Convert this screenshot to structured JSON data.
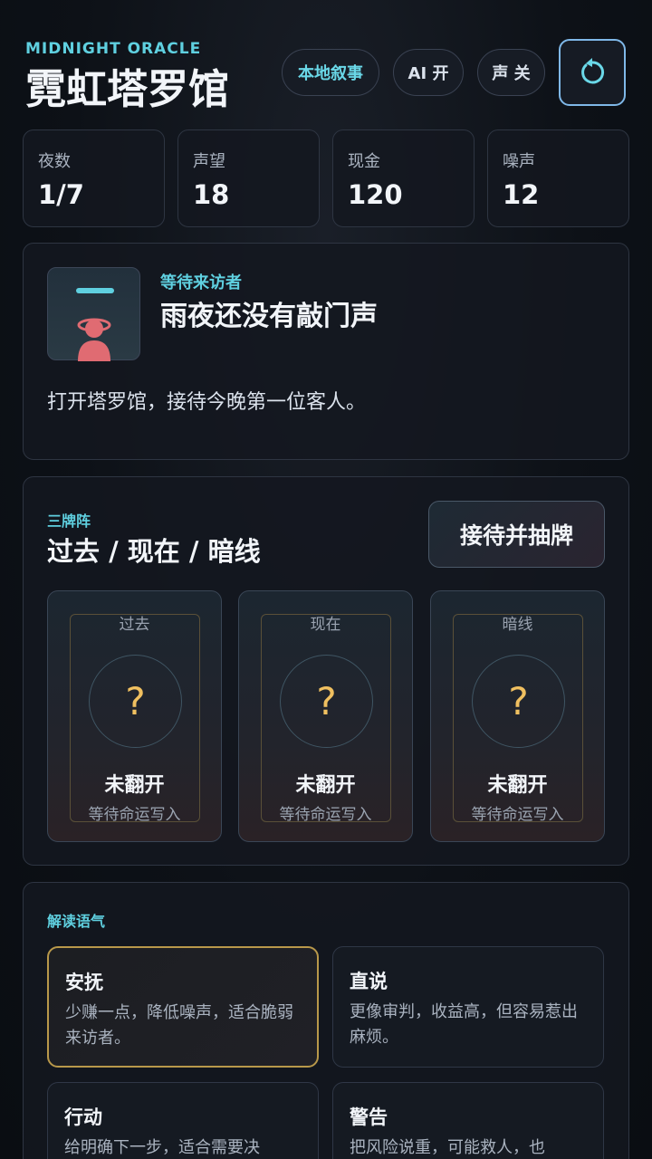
{
  "brand": {
    "subtitle": "MIDNIGHT ORACLE",
    "title": "霓虹塔罗馆"
  },
  "header": {
    "pill_narrative": "本地叙事",
    "pill_ai": "AI 开",
    "pill_sound": "声 关"
  },
  "stats": [
    {
      "label": "夜数",
      "value": "1/7"
    },
    {
      "label": "声望",
      "value": "18"
    },
    {
      "label": "现金",
      "value": "120"
    },
    {
      "label": "噪声",
      "value": "12"
    }
  ],
  "visitor": {
    "status": "等待来访者",
    "title": "雨夜还没有敲门声",
    "description": "打开塔罗馆，接待今晚第一位客人。"
  },
  "spread": {
    "eyebrow": "三牌阵",
    "title": "过去 / 现在 / 暗线",
    "action": "接待并抽牌",
    "cards": [
      {
        "position": "过去",
        "symbol": "?",
        "state": "未翻开",
        "hint": "等待命运写入"
      },
      {
        "position": "现在",
        "symbol": "?",
        "state": "未翻开",
        "hint": "等待命运写入"
      },
      {
        "position": "暗线",
        "symbol": "?",
        "state": "未翻开",
        "hint": "等待命运写入"
      }
    ]
  },
  "tone": {
    "eyebrow": "解读语气",
    "options": [
      {
        "title": "安抚",
        "desc": "少赚一点，降低噪声，适合脆弱来访者。"
      },
      {
        "title": "直说",
        "desc": "更像审判，收益高，但容易惹出麻烦。"
      },
      {
        "title": "行动",
        "desc": "给明确下一步，适合需要决"
      },
      {
        "title": "警告",
        "desc": "把风险说重，可能救人，也"
      }
    ]
  },
  "colors": {
    "accent": "#5fd0e0",
    "gold": "#f0c060",
    "selected_border": "#b8984a"
  }
}
